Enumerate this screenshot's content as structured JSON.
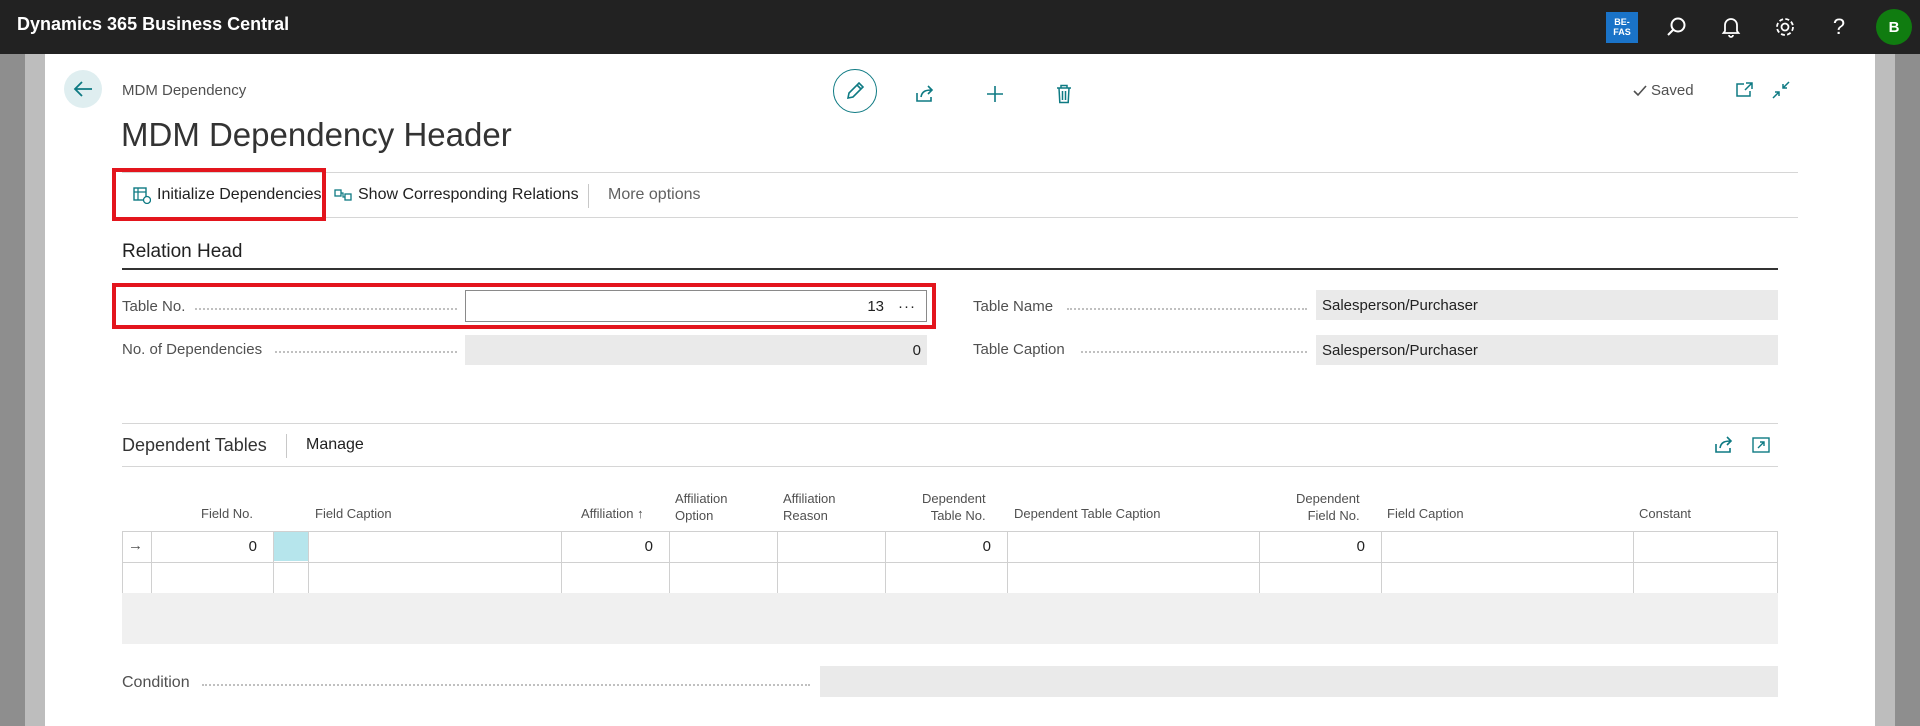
{
  "app": {
    "title": "Dynamics 365 Business Central",
    "company_badge": "BE-\nFAS",
    "user_initial": "B"
  },
  "page": {
    "breadcrumb": "MDM Dependency",
    "title": "MDM Dependency Header",
    "status": "Saved"
  },
  "actions": {
    "initialize": "Initialize Dependencies",
    "show_relations": "Show Corresponding Relations",
    "more_options": "More options"
  },
  "relation_head": {
    "section_title": "Relation Head",
    "table_no_label": "Table No.",
    "table_no_value": "13",
    "no_of_dependencies_label": "No. of Dependencies",
    "no_of_dependencies_value": "0",
    "table_name_label": "Table Name",
    "table_name_value": "Salesperson/Purchaser",
    "table_caption_label": "Table Caption",
    "table_caption_value": "Salesperson/Purchaser"
  },
  "dependent_tables": {
    "title": "Dependent Tables",
    "manage": "Manage",
    "columns": {
      "field_no": "Field No.",
      "field_caption": "Field Caption",
      "affiliation": "Affiliation",
      "affiliation_option_1": "Affiliation",
      "affiliation_option_2": "Option",
      "affiliation_reason_1": "Affiliation",
      "affiliation_reason_2": "Reason",
      "dependent_table_no_1": "Dependent",
      "dependent_table_no_2": "Table No.",
      "dependent_table_caption": "Dependent Table Caption",
      "dependent_field_no_1": "Dependent",
      "dependent_field_no_2": "Field No.",
      "field_caption_2": "Field Caption",
      "constant": "Constant"
    },
    "rows": [
      {
        "field_no": "0",
        "affiliation": "0",
        "dependent_table_no": "0",
        "dependent_field_no": "0"
      }
    ]
  },
  "condition": {
    "label": "Condition"
  },
  "colors": {
    "accent": "#0e7a83",
    "highlight": "#e3151d",
    "topbar": "#222222",
    "avatar": "#107c10"
  }
}
